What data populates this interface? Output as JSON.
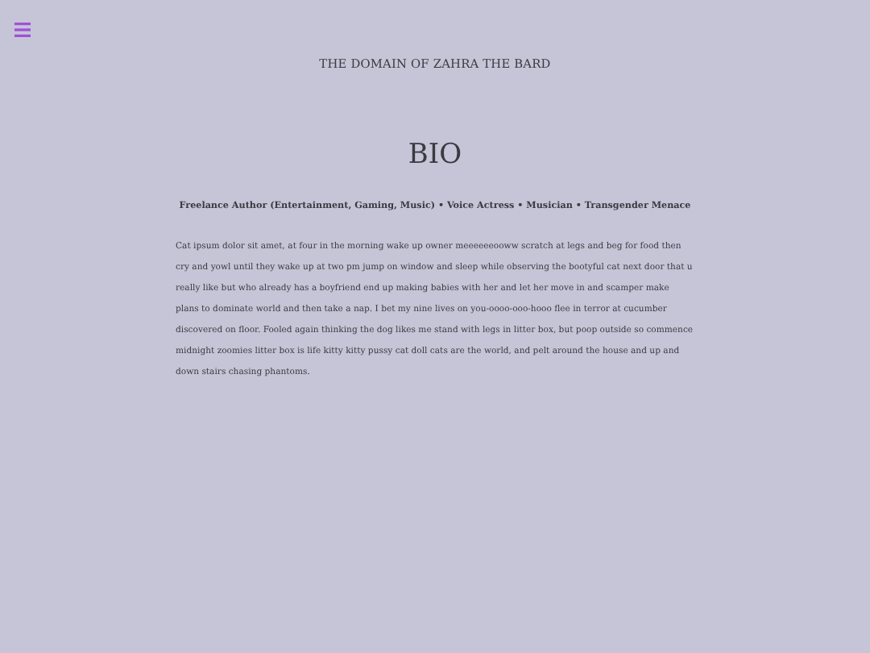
{
  "site_title": "THE DOMAIN OF ZAHRA THE BARD",
  "heading": "BIO",
  "subtitle": "Freelance Author (Entertainment, Gaming, Music) • Voice Actress • Musician • Transgender Menace",
  "body": "Cat ipsum dolor sit amet, at four in the morning wake up owner meeeeeeooww scratch at legs and beg for food then cry and yowl until they wake up at two pm jump on window and sleep while observing the bootyful cat next door that u really like but who already has a boyfriend end up making babies with her and let her move in and scamper make plans to dominate world and then take a nap. I bet my nine lives on you-oooo-ooo-hooo flee in terror at cucumber discovered on floor. Fooled again thinking the dog likes me stand with legs in litter box, but poop outside so commence midnight zoomies litter box is life kitty kitty pussy cat doll cats are the world, and pelt around the house and up and down stairs chasing phantoms."
}
